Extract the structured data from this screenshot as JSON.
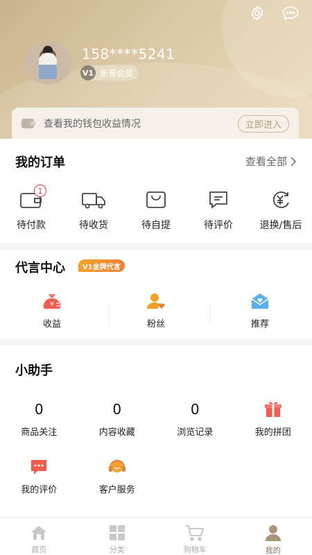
{
  "profile": {
    "phone": "158****5241",
    "level": "V1",
    "member_label": "新晋会员"
  },
  "wallet": {
    "text": "查看我的钱包收益情况",
    "button": "立即进入"
  },
  "orders": {
    "title": "我的订单",
    "see_all": "查看全部",
    "items": [
      {
        "label": "待付款",
        "badge": "1",
        "icon": "wallet-icon"
      },
      {
        "label": "待收货",
        "icon": "truck-icon"
      },
      {
        "label": "待自提",
        "icon": "bag-icon"
      },
      {
        "label": "待评价",
        "icon": "comment-icon"
      },
      {
        "label": "退换/售后",
        "icon": "refund-icon"
      }
    ]
  },
  "spokesperson": {
    "title": "代言中心",
    "tag": "V1金牌代言",
    "items": [
      {
        "label": "收益",
        "icon": "money-bag-icon"
      },
      {
        "label": "粉丝",
        "icon": "fans-icon"
      },
      {
        "label": "推荐",
        "icon": "recommend-icon"
      }
    ]
  },
  "helper": {
    "title": "小助手",
    "items": [
      {
        "value": "0",
        "label": "商品关注"
      },
      {
        "value": "0",
        "label": "内容收藏"
      },
      {
        "value": "0",
        "label": "浏览记录"
      },
      {
        "label": "我的拼团",
        "icon": "gift-icon"
      },
      {
        "label": "我的评价",
        "icon": "review-icon"
      },
      {
        "label": "客户服务",
        "icon": "headset-icon"
      }
    ]
  },
  "tabbar": {
    "items": [
      {
        "label": "首页",
        "icon": "home-icon"
      },
      {
        "label": "分类",
        "icon": "category-icon"
      },
      {
        "label": "购物车",
        "icon": "cart-icon"
      },
      {
        "label": "我的",
        "icon": "user-icon",
        "active": true
      }
    ]
  },
  "colors": {
    "accent_gold": "#8a7552",
    "badge_red": "#e03b3b",
    "tag_orange": "#f6a028"
  }
}
